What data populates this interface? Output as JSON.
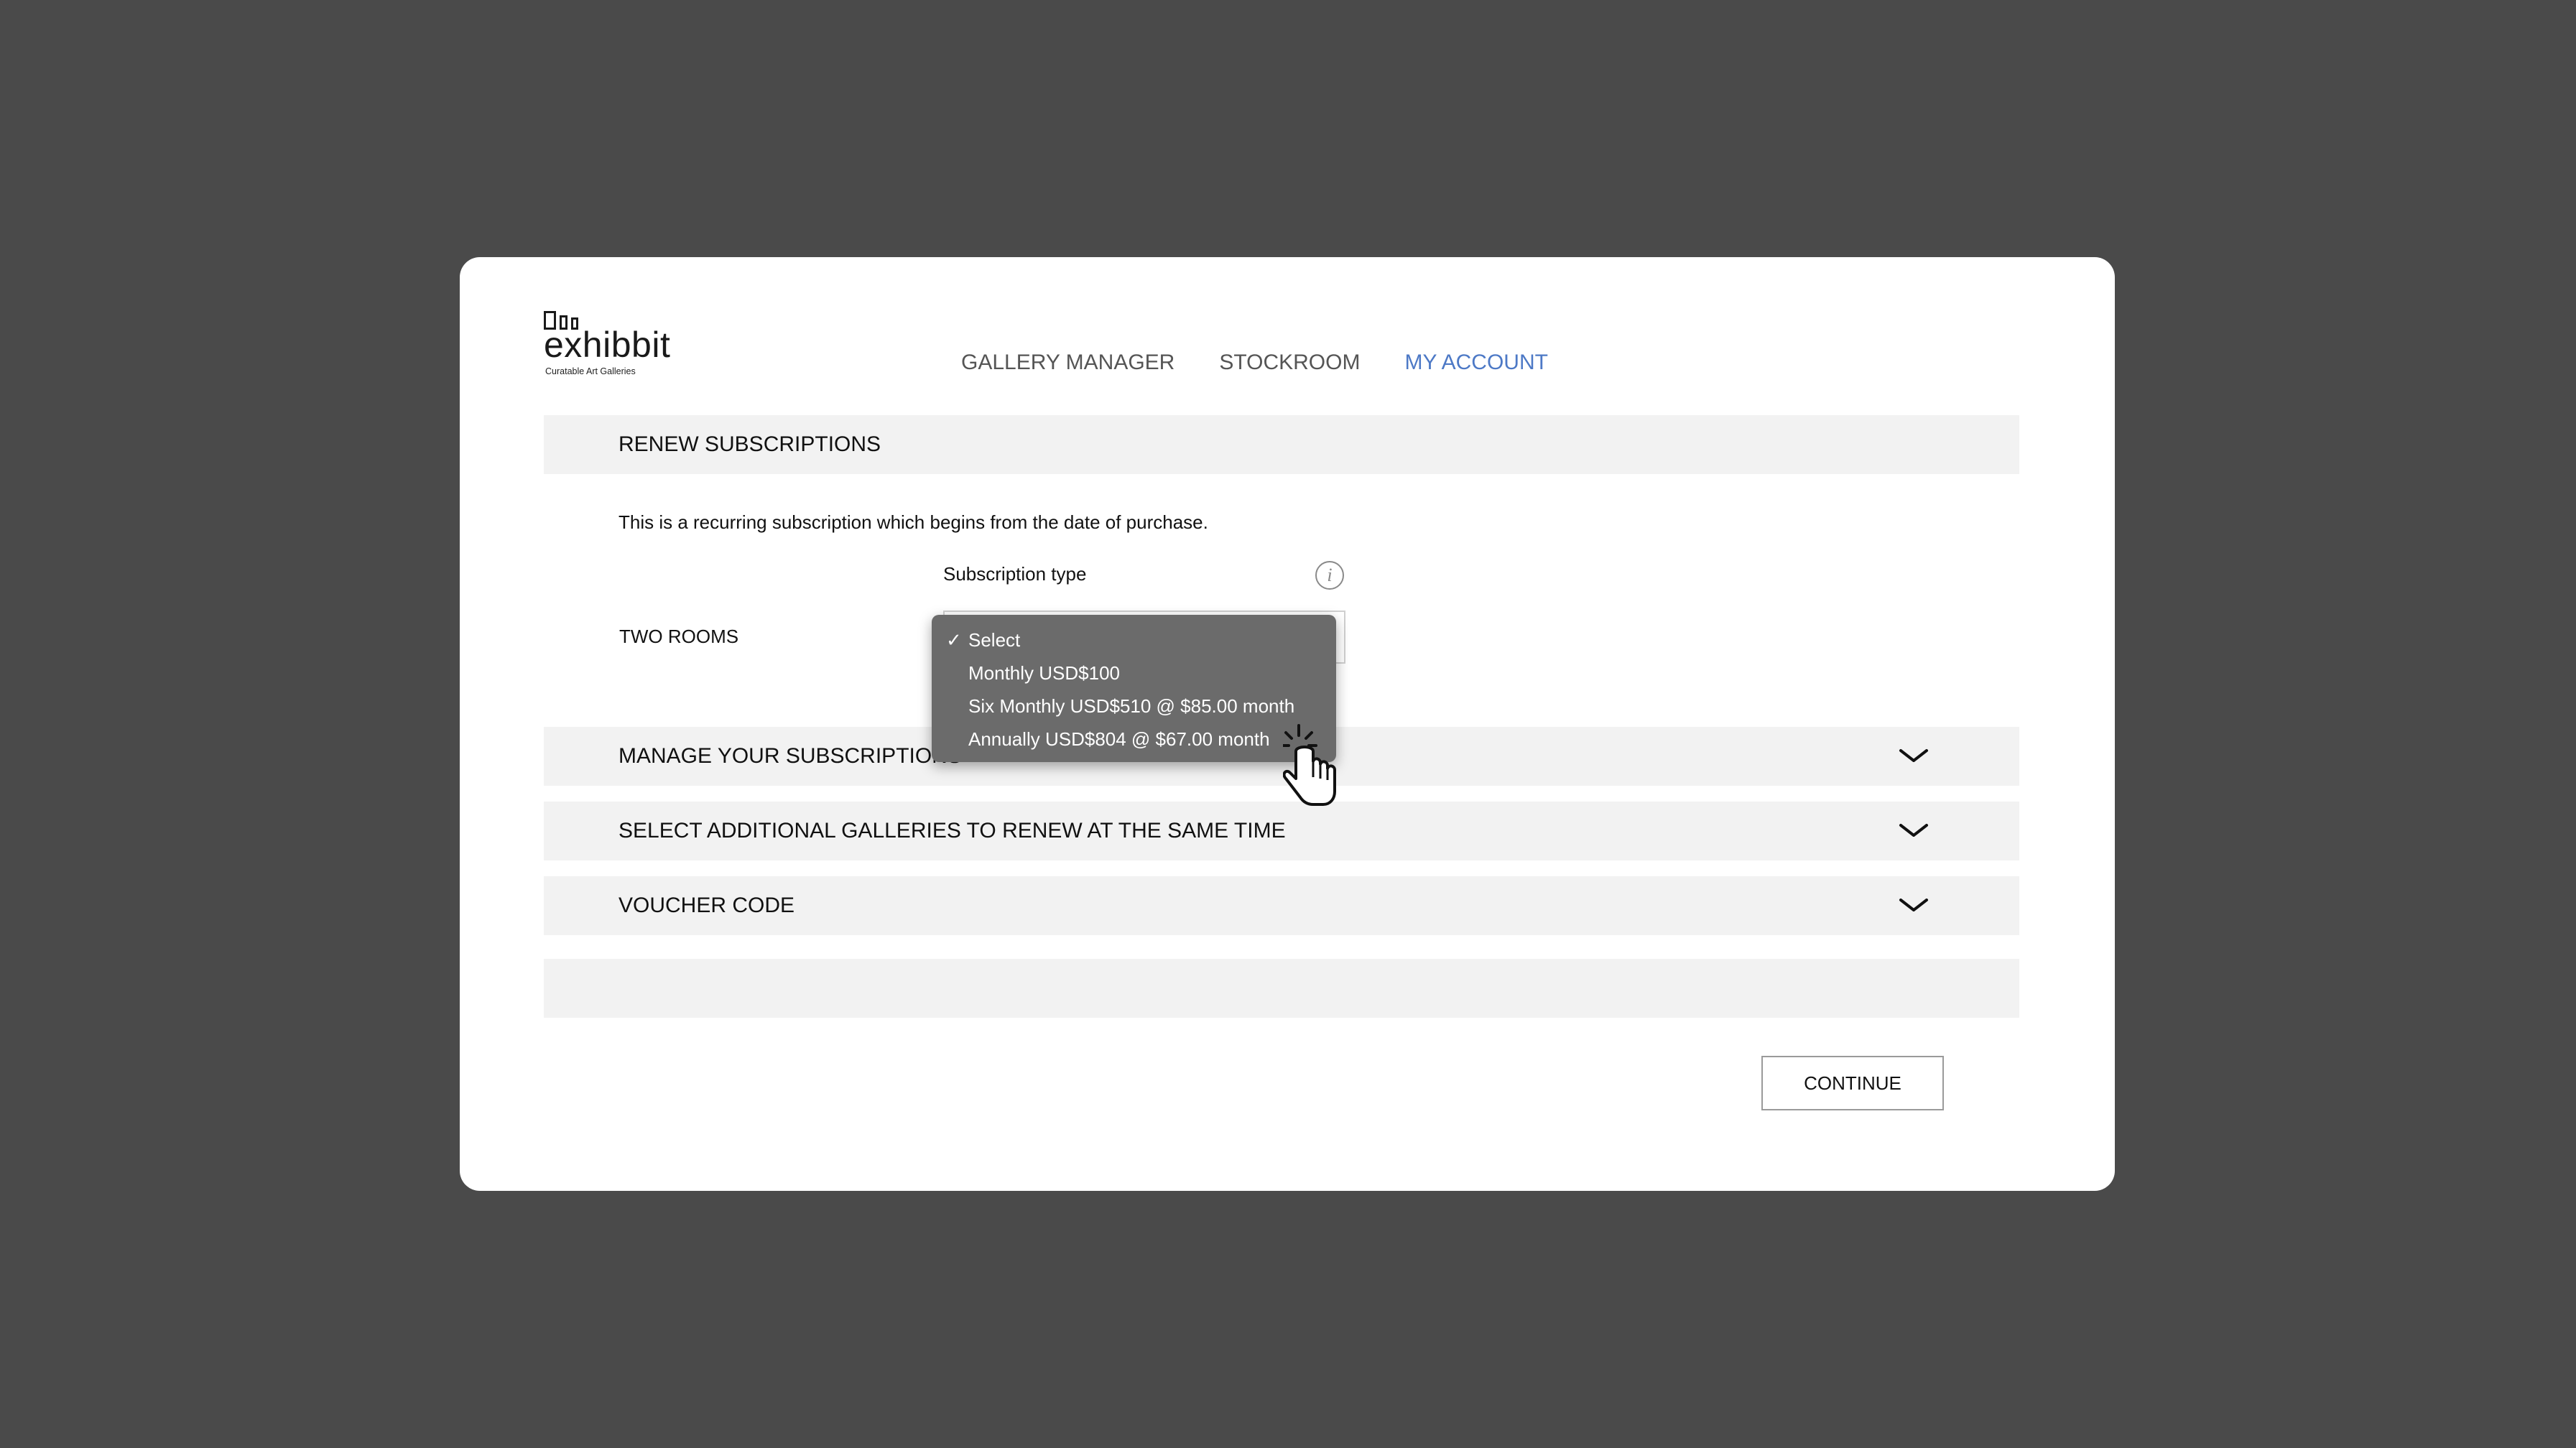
{
  "brand": {
    "name": "exhibbit",
    "tagline": "Curatable Art Galleries"
  },
  "nav": {
    "items": [
      {
        "label": "GALLERY MANAGER",
        "active": false
      },
      {
        "label": "STOCKROOM",
        "active": false
      },
      {
        "label": "MY ACCOUNT",
        "active": true
      }
    ]
  },
  "renew": {
    "title": "RENEW SUBSCRIPTIONS",
    "description": "This is a recurring subscription which begins from the date of purchase.",
    "subscription_type_label": "Subscription type",
    "gallery_name": "TWO ROOMS",
    "dropdown": {
      "selected": "Select",
      "options": [
        "Select",
        "Monthly USD$100",
        "Six Monthly USD$510 @ $85.00 month",
        "Annually USD$804 @ $67.00 month"
      ]
    }
  },
  "sections": {
    "manage": "MANAGE YOUR SUBSCRIPTIONS",
    "additional": "SELECT ADDITIONAL GALLERIES TO RENEW AT THE SAME TIME",
    "voucher": "VOUCHER CODE"
  },
  "actions": {
    "continue_label": "CONTINUE"
  },
  "colors": {
    "background": "#4a4a4a",
    "card": "#ffffff",
    "bar": "#f2f2f2",
    "nav_active": "#4d79c6",
    "dropdown": "#6b6b6b"
  },
  "icons": {
    "info": "info-icon",
    "chevron": "chevron-down-icon",
    "cursor": "hand-pointer-icon"
  }
}
